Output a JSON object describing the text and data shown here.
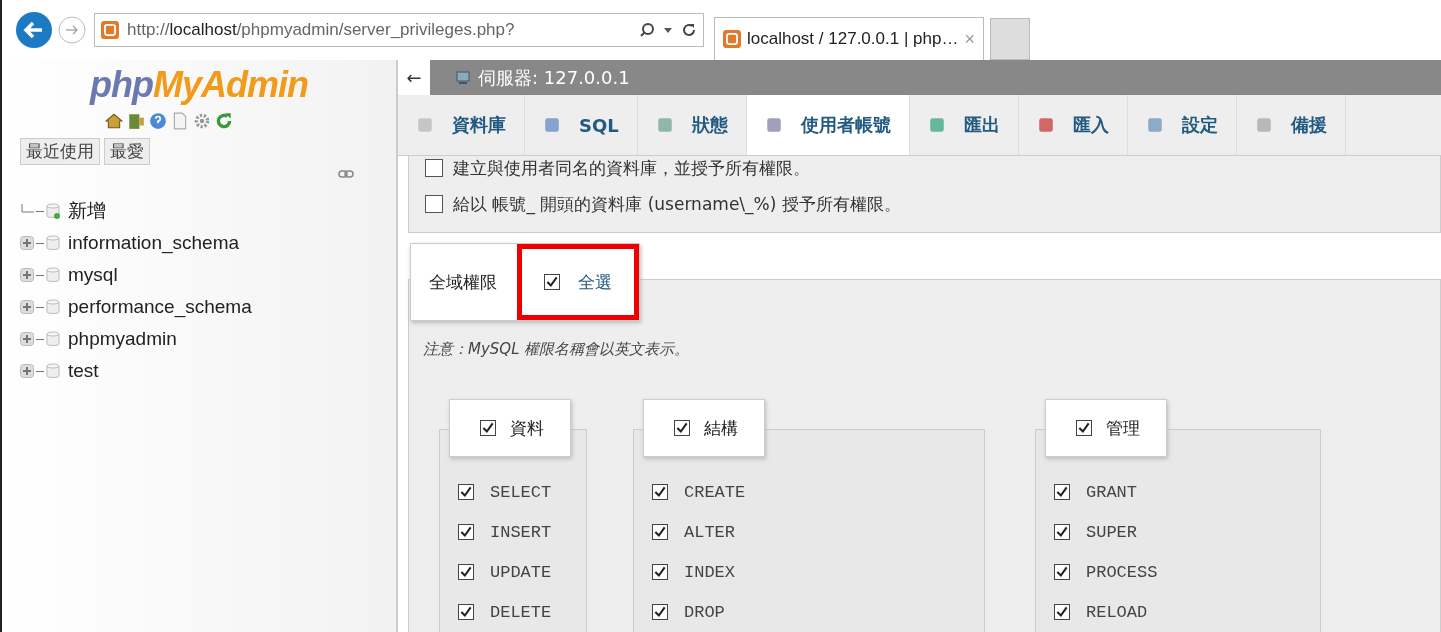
{
  "browser": {
    "address": {
      "prefix": "http://",
      "host": "localhost",
      "path": "/phpmyadmin/server_privileges.php?"
    },
    "tab": {
      "title": "localhost / 127.0.0.1 | php…",
      "close": "×"
    }
  },
  "sidebar": {
    "logo": {
      "part_1": "php",
      "part_2": "MyAdmin"
    },
    "buttons": [
      "最近使用",
      "最愛"
    ],
    "tree": [
      {
        "label": "新增",
        "kind": "new"
      },
      {
        "label": "information_schema",
        "kind": "database"
      },
      {
        "label": "mysql",
        "kind": "database"
      },
      {
        "label": "performance_schema",
        "kind": "database"
      },
      {
        "label": "phpmyadmin",
        "kind": "database"
      },
      {
        "label": "test",
        "kind": "database"
      }
    ]
  },
  "header": {
    "back": "←",
    "server": "伺服器: 127.0.0.1"
  },
  "tabs": [
    {
      "label": "資料庫",
      "selected": false,
      "kind": "database"
    },
    {
      "label": "SQL",
      "selected": false,
      "kind": "sql"
    },
    {
      "label": "狀態",
      "selected": false,
      "kind": "status"
    },
    {
      "label": "使用者帳號",
      "selected": true,
      "kind": "users"
    },
    {
      "label": "匯出",
      "selected": false,
      "kind": "export"
    },
    {
      "label": "匯入",
      "selected": false,
      "kind": "import"
    },
    {
      "label": "設定",
      "selected": false,
      "kind": "settings"
    },
    {
      "label": "備援",
      "selected": false,
      "kind": "replication"
    }
  ],
  "options": [
    {
      "label": "建立與使用者同名的資料庫，並授予所有權限。",
      "checked": false
    },
    {
      "label": "給以 帳號_ 開頭的資料庫 (username\\_%) 授予所有權限。",
      "checked": false
    }
  ],
  "privileges": {
    "legend": "全域權限",
    "select_all": {
      "label": "全選",
      "checked": true,
      "highlighted": true
    },
    "note": "注意：MySQL 權限名稱會以英文表示。",
    "groups": [
      {
        "title": "資料",
        "checked": true,
        "items": [
          {
            "label": "SELECT",
            "checked": true
          },
          {
            "label": "INSERT",
            "checked": true
          },
          {
            "label": "UPDATE",
            "checked": true
          },
          {
            "label": "DELETE",
            "checked": true
          }
        ]
      },
      {
        "title": "結構",
        "checked": true,
        "items": [
          {
            "label": "CREATE",
            "checked": true
          },
          {
            "label": "ALTER",
            "checked": true
          },
          {
            "label": "INDEX",
            "checked": true
          },
          {
            "label": "DROP",
            "checked": true
          }
        ]
      },
      {
        "title": "管理",
        "checked": true,
        "items": [
          {
            "label": "GRANT",
            "checked": true
          },
          {
            "label": "SUPER",
            "checked": true
          },
          {
            "label": "PROCESS",
            "checked": true
          },
          {
            "label": "RELOAD",
            "checked": true
          }
        ]
      }
    ]
  }
}
